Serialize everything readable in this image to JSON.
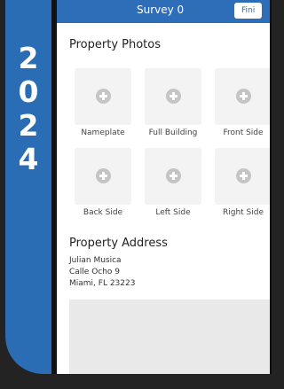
{
  "year": {
    "digits": [
      "2",
      "0",
      "2",
      "4"
    ]
  },
  "header": {
    "title": "Survey 0",
    "finish_label": "Fini"
  },
  "photos": {
    "title": "Property Photos",
    "items": [
      {
        "label": "Nameplate"
      },
      {
        "label": "Full Building"
      },
      {
        "label": "Front Side"
      },
      {
        "label": "Back Side"
      },
      {
        "label": "Left Side"
      },
      {
        "label": "Right Side"
      }
    ]
  },
  "address": {
    "title": "Property Address",
    "lines": [
      "Julian Musica",
      "Calle Ocho 9",
      "Miami, FL 23223"
    ]
  },
  "colors": {
    "accent": "#2e6db8",
    "year_panel": "#2a6db4",
    "background": "#232323"
  }
}
